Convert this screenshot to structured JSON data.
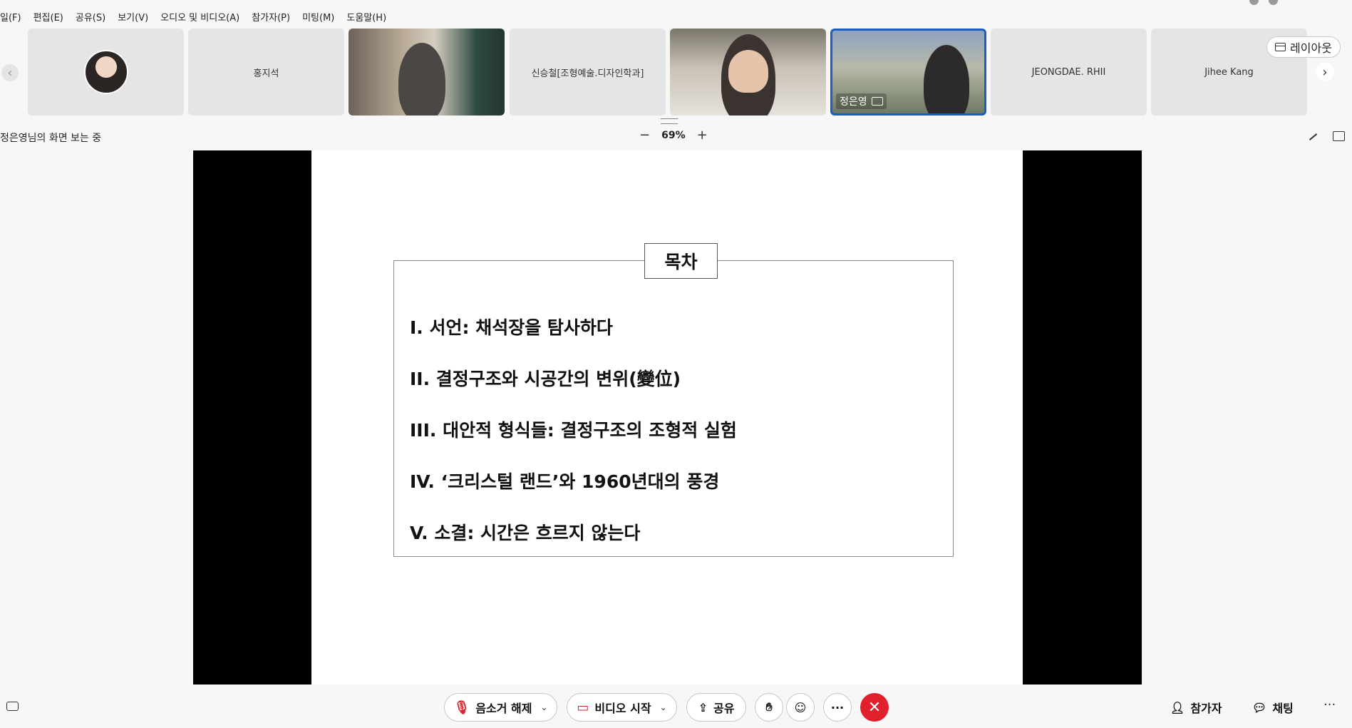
{
  "menu": [
    "일(F)",
    "편집(E)",
    "공유(S)",
    "보기(V)",
    "오디오 및 비디오(A)",
    "참가자(P)",
    "미팅(M)",
    "도움말(H)"
  ],
  "participants": [
    {
      "name": "",
      "kind": "avatar"
    },
    {
      "name": "홍지석",
      "kind": "name"
    },
    {
      "name": "",
      "kind": "video"
    },
    {
      "name": "신승철[조형예술.디자인학과]",
      "kind": "name"
    },
    {
      "name": "",
      "kind": "video"
    },
    {
      "name": "정은영",
      "kind": "video-active"
    },
    {
      "name": "JEONGDAE. RHII",
      "kind": "name"
    },
    {
      "name": "Jihee Kang",
      "kind": "name"
    }
  ],
  "layout_button": "레이아웃",
  "share_status": "정은영님의 화면 보는 중",
  "zoom": {
    "minus": "−",
    "level": "69%",
    "plus": "+"
  },
  "slide": {
    "title": "목차",
    "items": [
      "I.  서언: 채석장을 탐사하다",
      "II.  결정구조와 시공간의 변위(變位)",
      "III. 대안적 형식들: 결정구조의 조형적 실험",
      "IV. ‘크리스털 랜드’와 1960년대의 풍경",
      "V.  소결: 시간은 흐르지 않는다"
    ]
  },
  "toolbar": {
    "unmute": "음소거 해제",
    "start_video": "비디오 시작",
    "share": "공유",
    "more": "···",
    "participants": "참가자",
    "chat": "채팅",
    "overflow": "···"
  },
  "colors": {
    "accent": "#1e5cc0",
    "end_call": "#e0202a",
    "muted": "#d8262f"
  }
}
